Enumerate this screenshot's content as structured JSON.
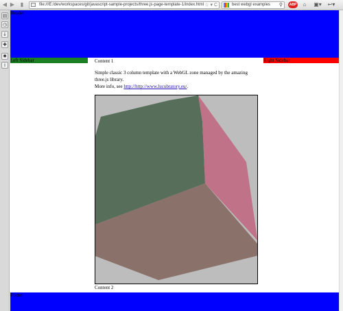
{
  "browser": {
    "url": "file:///E:/dev/workspaces/git/javascript-sample-projects/three.js-page-template-1/index.html",
    "search_text": "best webgl examples",
    "abp_label": "ABP",
    "icons": {
      "back": "back-arrow-icon",
      "forward": "forward-arrow-icon",
      "reload": "reload-icon",
      "home": "home-icon",
      "search": "search-icon"
    }
  },
  "side_strip": {
    "buttons": [
      "bookmarks-icon",
      "history-icon",
      "downloads-icon",
      "addons-icon",
      "settings-icon",
      "info-icon"
    ]
  },
  "page": {
    "header_label": "Header",
    "footer_label": "Footer",
    "left_sidebar_label": "Left Sidebar",
    "right_sidebar_label": "Right Sidebar",
    "content1_title": "Content 1",
    "description": "Simple classic 3 column template with a WebGL zone managed by the amazing three.js library.",
    "more_info_prefix": "More info, see ",
    "more_info_link": "http://http://www.lucubratory.eu/",
    "more_info_suffix": ".",
    "content2_title": "Content 2"
  },
  "colors": {
    "header": "#0000ff",
    "footer": "#0000ff",
    "left_sidebar": "#1b7f24",
    "right_sidebar": "#ff0000",
    "webgl_background": "#bdbdbd",
    "cube_face_green": "#566e5a",
    "cube_face_pink": "#c07388",
    "cube_face_brown": "#8a7169"
  }
}
